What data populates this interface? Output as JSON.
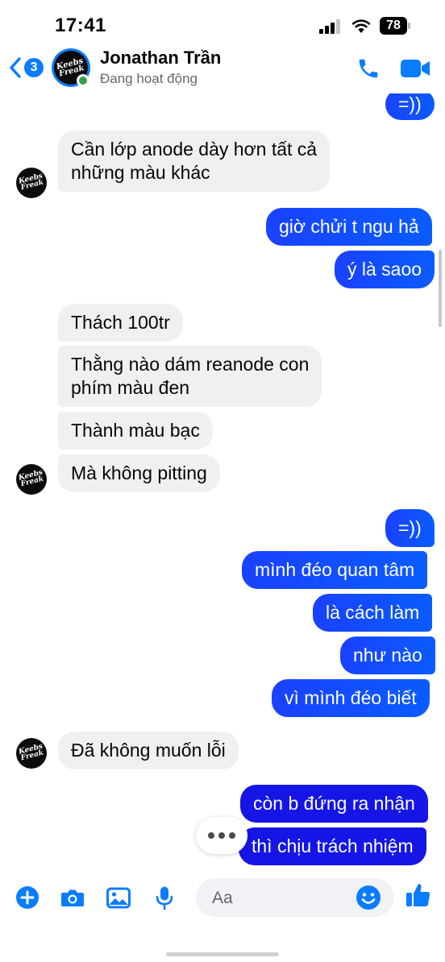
{
  "status_bar": {
    "time": "17:41",
    "battery": "78"
  },
  "header": {
    "back_count": "3",
    "contact_name": "Jonathan Trần",
    "contact_status": "Đang hoạt động",
    "avatar_text_line1": "Keebs",
    "avatar_text_line2": "Freak"
  },
  "messages": [
    {
      "side": "out",
      "text": "=))"
    },
    {
      "side": "in",
      "text": "Cần lớp anode dày hơn tất cả"
    },
    {
      "side": "in",
      "text": "những màu khác"
    },
    {
      "side": "out",
      "text": "giờ chửi t ngu hả"
    },
    {
      "side": "out",
      "text": "ý là saoo"
    },
    {
      "side": "in",
      "text": "Thách 100tr"
    },
    {
      "side": "in",
      "text": "Thằng nào dám reanode con"
    },
    {
      "side": "in",
      "text": "phím màu đen"
    },
    {
      "side": "in",
      "text": "Thành màu bạc"
    },
    {
      "side": "in",
      "text": "Mà không pitting"
    },
    {
      "side": "out",
      "text": "=))"
    },
    {
      "side": "out",
      "text": "mình đéo quan tâm"
    },
    {
      "side": "out",
      "text": "là cách làm"
    },
    {
      "side": "out",
      "text": "như nào"
    },
    {
      "side": "out",
      "text": "vì mình đéo biết"
    },
    {
      "side": "in",
      "text": "Đã không muốn lỗi"
    },
    {
      "side": "out",
      "text": "còn b đứng ra nhận"
    },
    {
      "side": "out",
      "text": "thì chịu trách nhiệm"
    }
  ],
  "composer": {
    "placeholder": "Aa"
  },
  "colors": {
    "accent": "#0a7cff",
    "outgoing_bubble": "#1a41ff",
    "incoming_bubble": "#f0f0f0",
    "online": "#31a24c"
  },
  "icons": {
    "back": "chevron-left-icon",
    "call": "phone-icon",
    "video": "video-camera-icon",
    "add": "plus-circle-icon",
    "camera": "camera-icon",
    "gallery": "image-icon",
    "mic": "microphone-icon",
    "emoji": "smiley-icon",
    "like": "thumbs-up-icon",
    "typing": "typing-dots-icon"
  }
}
